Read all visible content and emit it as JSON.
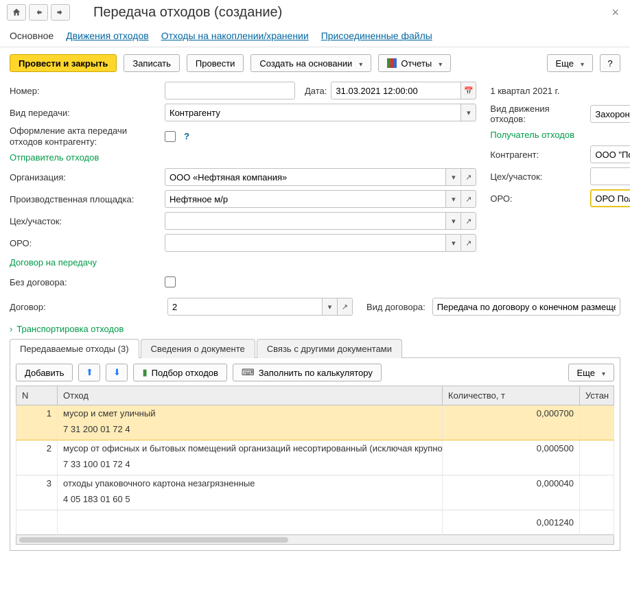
{
  "header": {
    "title": "Передача отходов (создание)"
  },
  "navtabs": {
    "main": "Основное",
    "movement": "Движения отходов",
    "storage": "Отходы на накоплении/хранении",
    "files": "Присоединенные файлы"
  },
  "toolbar": {
    "post_close": "Провести и закрыть",
    "save": "Записать",
    "post": "Провести",
    "create_based": "Создать на основании",
    "reports": "Отчеты",
    "more": "Еще",
    "help": "?"
  },
  "form": {
    "number_lbl": "Номер:",
    "number_val": "",
    "date_lbl": "Дата:",
    "date_val": "31.03.2021 12:00:00",
    "period_val": "1 квартал 2021 г.",
    "transfer_type_lbl": "Вид передачи:",
    "transfer_type_val": "Контрагенту",
    "movement_kind_lbl": "Вид движения отходов:",
    "movement_kind_val": "Захоронение",
    "act_lbl": "Оформление акта передачи отходов контрагенту:",
    "sender_hdr": "Отправитель отходов",
    "recipient_hdr": "Получатель отходов",
    "org_lbl": "Организация:",
    "org_val": "ООО «Нефтяная компания»",
    "contractor_lbl": "Контрагент:",
    "contractor_val": "ООО \"Полигон ТБО\" п",
    "site_lbl": "Производственная площадка:",
    "site_val": "Нефтяное м/р",
    "workshop_lbl": "Цех/участок:",
    "workshop_val": "",
    "workshop2_val": "",
    "oro_lbl": "ОРО:",
    "oro_val": "",
    "oro2_val": "ОРО Полигон",
    "contract_hdr": "Договор на передачу",
    "no_contract_lbl": "Без договора:",
    "contract_lbl": "Договор:",
    "contract_val": "2",
    "contract_type_lbl": "Вид договора:",
    "contract_type_val": "Передача по договору о конечном размеще"
  },
  "collapse": {
    "transport": "Транспортировка отходов"
  },
  "tabs": {
    "waste": "Передаваемые отходы (3)",
    "docinfo": "Сведения о документе",
    "links": "Связь с другими документами"
  },
  "tab_toolbar": {
    "add": "Добавить",
    "pick": "Подбор отходов",
    "fill": "Заполнить по калькулятору",
    "more": "Еще"
  },
  "table": {
    "hdr_n": "N",
    "hdr_waste": "Отход",
    "hdr_qty": "Количество, т",
    "hdr_ust": "Устан",
    "rows": [
      {
        "n": "1",
        "name": "мусор и смет уличный",
        "code": "7 31 200 01 72 4",
        "qty": "0,000700"
      },
      {
        "n": "2",
        "name": "мусор от офисных и бытовых помещений организаций несортированный (исключая крупногаб...",
        "code": "7 33 100 01 72 4",
        "qty": "0,000500"
      },
      {
        "n": "3",
        "name": "отходы упаковочного картона незагрязненные",
        "code": "4 05 183 01 60 5",
        "qty": "0,000040"
      }
    ],
    "total_qty": "0,001240"
  }
}
